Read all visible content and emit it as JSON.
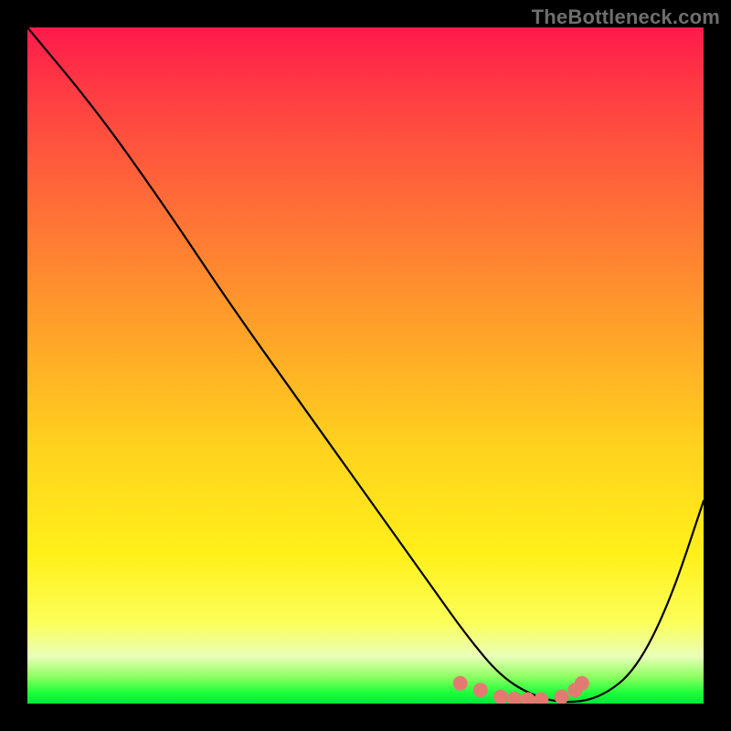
{
  "watermark": "TheBottleneck.com",
  "chart_data": {
    "type": "line",
    "title": "",
    "xlabel": "",
    "ylabel": "",
    "xlim": [
      0,
      100
    ],
    "ylim": [
      0,
      100
    ],
    "grid": false,
    "legend": false,
    "background": "rainbow-gradient-vertical",
    "series": [
      {
        "name": "curve",
        "color": "#000000",
        "x": [
          0,
          10,
          20,
          30,
          40,
          50,
          60,
          65,
          70,
          75,
          80,
          85,
          90,
          95,
          100
        ],
        "y": [
          100,
          88,
          74,
          59,
          45,
          31,
          17,
          10,
          4,
          1,
          0,
          1,
          5,
          15,
          30
        ]
      }
    ],
    "markers": {
      "name": "highlight-dots",
      "color": "#e37a72",
      "radius": 8,
      "x": [
        64,
        67,
        70,
        72,
        74,
        76,
        79,
        81,
        82
      ],
      "y": [
        3,
        2,
        1,
        0.7,
        0.6,
        0.6,
        1,
        2,
        3
      ]
    }
  }
}
